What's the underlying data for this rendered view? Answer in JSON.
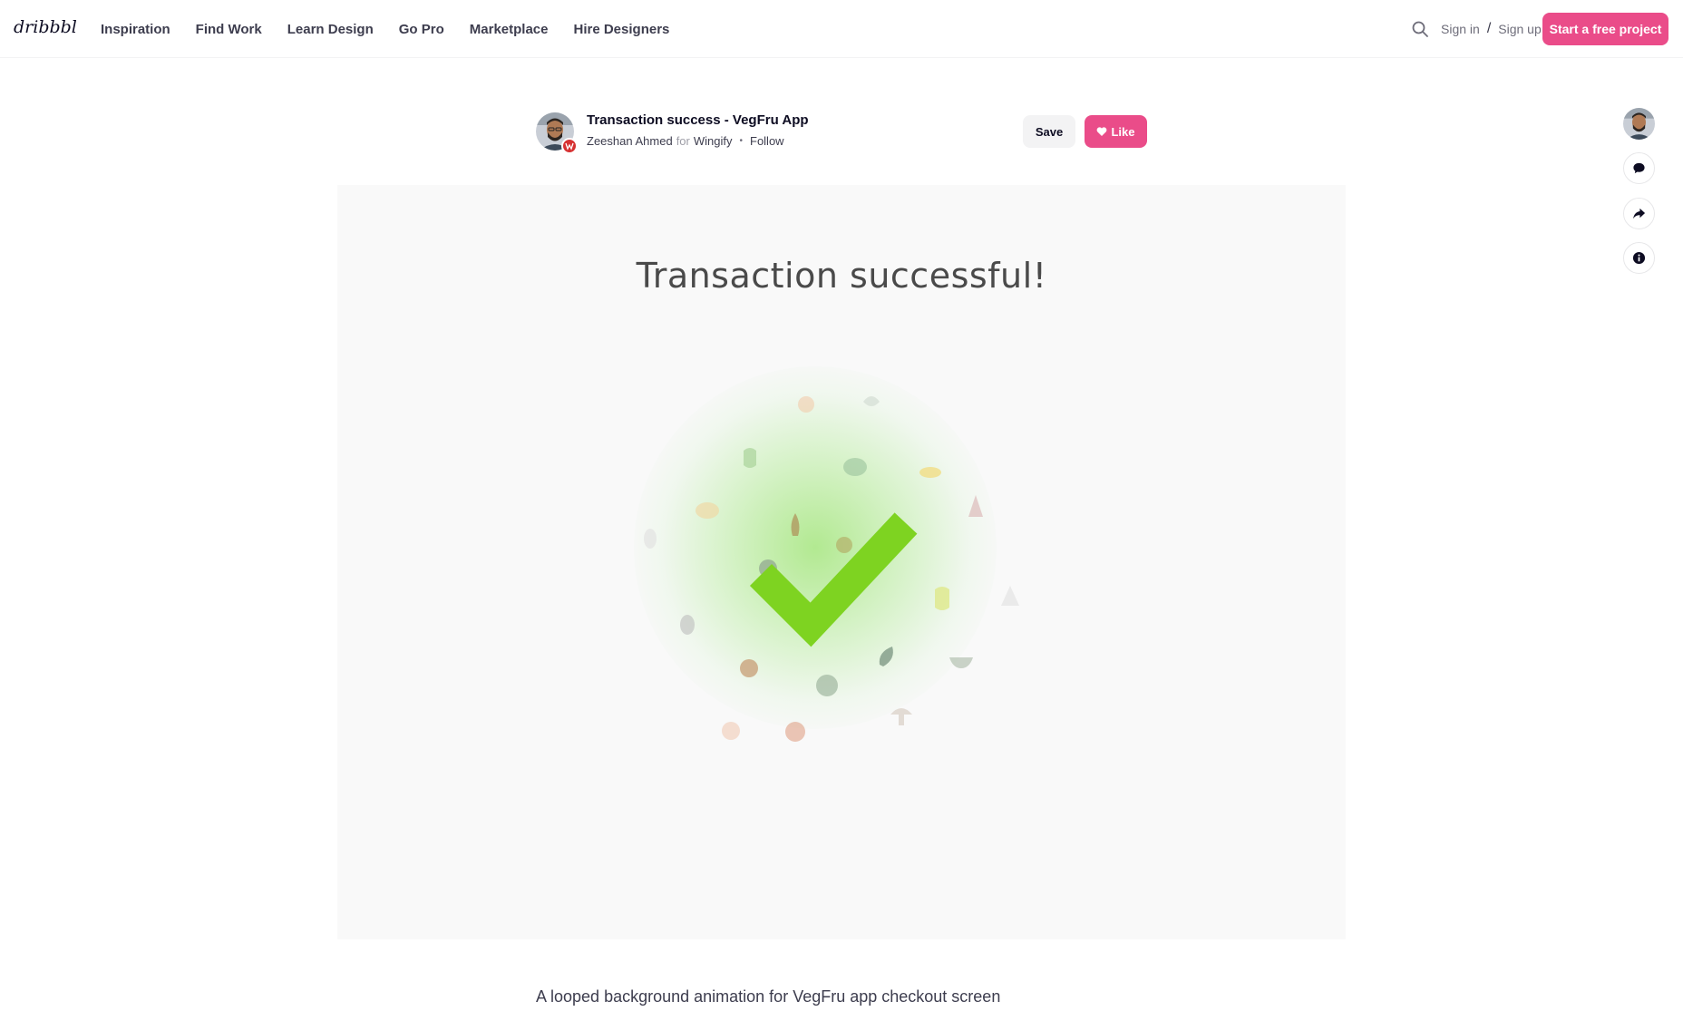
{
  "header": {
    "logo": "dribbble",
    "nav": [
      "Inspiration",
      "Find Work",
      "Learn Design",
      "Go Pro",
      "Marketplace",
      "Hire Designers"
    ],
    "search_icon": "search-icon",
    "sign_in": "Sign in",
    "separator": "/",
    "sign_up": "Sign up",
    "cta": "Start a free project"
  },
  "shot": {
    "title": "Transaction success - VegFru App",
    "author": "Zeeshan Ahmed",
    "for_label": "for",
    "team": "Wingify",
    "follow": "Follow",
    "save": "Save",
    "like": "Like",
    "heading": "Transaction successful!",
    "description": "A looped background animation for VegFru app checkout screen"
  },
  "colors": {
    "brand_pink": "#ea4c89",
    "check_green": "#7ed321",
    "badge_red": "#d63031"
  },
  "rail": {
    "icons": [
      "avatar",
      "comment-icon",
      "share-icon",
      "info-icon"
    ]
  }
}
